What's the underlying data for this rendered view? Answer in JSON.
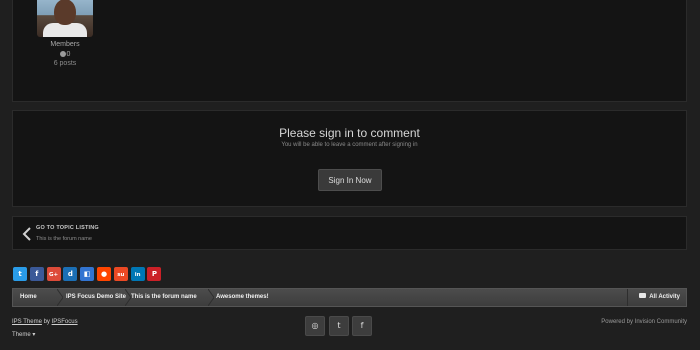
{
  "author": {
    "group": "Members",
    "reputation": "0",
    "posts": "6 posts"
  },
  "signin": {
    "title": "Please sign in to comment",
    "subtitle": "You will be able to leave a comment after signing in",
    "button": "Sign In Now"
  },
  "topic_link": {
    "label": "GO TO TOPIC LISTING",
    "forum": "This is the forum name"
  },
  "share": [
    {
      "icon": "twitter-icon",
      "glyph": "t",
      "color": "#2a9ce8"
    },
    {
      "icon": "facebook-icon",
      "glyph": "f",
      "color": "#3b5998"
    },
    {
      "icon": "google-plus-icon",
      "glyph": "G+",
      "color": "#dd4b39"
    },
    {
      "icon": "digg-icon",
      "glyph": "d",
      "color": "#1b6fb5"
    },
    {
      "icon": "delicious-icon",
      "glyph": "◧",
      "color": "#3274d1"
    },
    {
      "icon": "reddit-icon",
      "glyph": "●",
      "color": "#ff4500"
    },
    {
      "icon": "stumbleupon-icon",
      "glyph": "su",
      "color": "#eb4924"
    },
    {
      "icon": "linkedin-icon",
      "glyph": "in",
      "color": "#0077b5"
    },
    {
      "icon": "pinterest-icon",
      "glyph": "P",
      "color": "#cb2027"
    }
  ],
  "breadcrumb": {
    "items": [
      "Home",
      "IPS Focus Demo Site",
      "This is the forum name",
      "Awesome themes!"
    ],
    "activity": "All Activity"
  },
  "footer": {
    "theme_prefix": "IPS Theme",
    "theme_by": " by ",
    "theme_author": "IPSFocus",
    "theme_menu": "Theme",
    "powered": "Powered by Invision Community",
    "social": [
      {
        "icon": "instagram-icon",
        "glyph": "◎"
      },
      {
        "icon": "twitter-icon",
        "glyph": "t"
      },
      {
        "icon": "facebook-icon",
        "glyph": "f"
      }
    ]
  },
  "colors": {
    "background": "#1f1f1f",
    "panel": "#141414",
    "breadcrumb": "#454545"
  }
}
